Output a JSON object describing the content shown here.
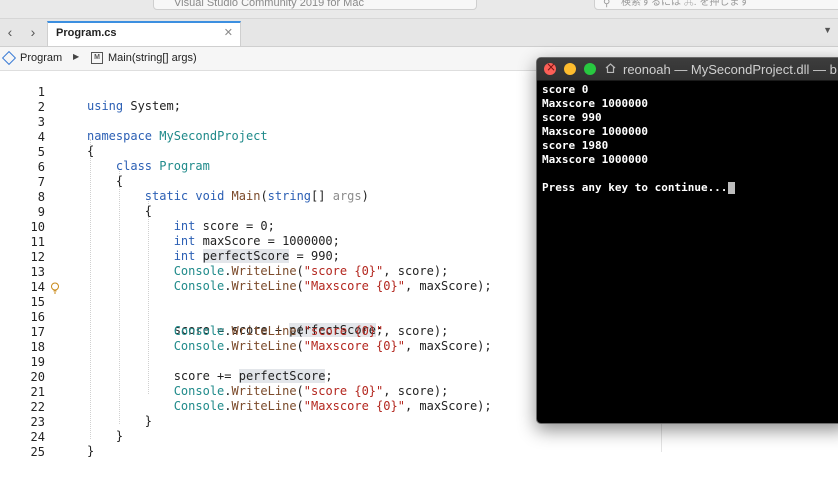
{
  "app": {
    "window_title": "Visual Studio Community 2019 for Mac",
    "search_placeholder": "検索するには ⌘. を押します"
  },
  "tabs": [
    {
      "label": "Program.cs",
      "active": true
    }
  ],
  "breadcrumb": {
    "class_label": "Program",
    "method_label": "Main(string[] args)"
  },
  "editor": {
    "line_numbers": [
      "1",
      "2",
      "3",
      "4",
      "5",
      "6",
      "7",
      "8",
      "9",
      "10",
      "11",
      "12",
      "13",
      "14",
      "15",
      "16",
      "17",
      "18",
      "19",
      "20",
      "21",
      "22",
      "23",
      "24",
      "25"
    ],
    "lines": [
      "using System;",
      "",
      "namespace MySecondProject",
      "{",
      "    class Program",
      "    {",
      "        static void Main(string[] args)",
      "        {",
      "            int score = 0;",
      "            int maxScore = 1000000;",
      "            int perfectScore = 990;",
      "            Console.WriteLine(\"score {0}\", score);",
      "            Console.WriteLine(\"Maxscore {0}\", maxScore);",
      "",
      "            score = score + perfectScore;",
      "            Console.WriteLine(\"score {0}\", score);",
      "            Console.WriteLine(\"Maxscore {0}\", maxScore);",
      "",
      "            score += perfectScore;",
      "            Console.WriteLine(\"score {0}\", score);",
      "            Console.WriteLine(\"Maxscore {0}\", maxScore);",
      "        }",
      "    }",
      "}",
      ""
    ],
    "lightbulb_line": "15"
  },
  "terminal": {
    "title": "reonoah — MySecondProject.dll — b",
    "output": [
      "score 0",
      "Maxscore 1000000",
      "score 990",
      "Maxscore 1000000",
      "score 1980",
      "Maxscore 1000000",
      "",
      "Press any key to continue..."
    ]
  },
  "colors": {
    "keyword": "#2b5fb4",
    "string": "#b3261e",
    "class": "#1f8a8a",
    "terminal_bg": "#000000",
    "tab_accent": "#3c8fe0"
  }
}
